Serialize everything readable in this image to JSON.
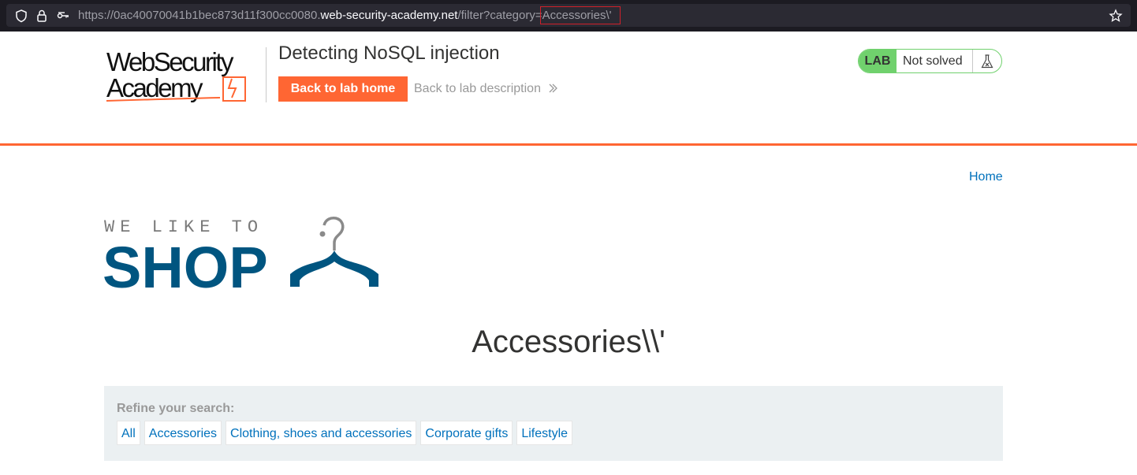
{
  "browser": {
    "url_prefix": "https://0ac40070041b1bec873d11f300cc0080.",
    "url_domain": "web-security-academy.net",
    "url_path": "/filter?category=",
    "url_param": "Accessories\\'"
  },
  "lab_header": {
    "logo_line1": "WebSecurity",
    "logo_line2": "Academy",
    "title": "Detecting NoSQL injection",
    "back_home_label": "Back to lab home",
    "back_description_label": "Back to lab description",
    "status_tag": "LAB",
    "status_text": "Not solved"
  },
  "nav": {
    "home_label": "Home"
  },
  "shop_logo": {
    "tagline": "WE LIKE TO",
    "word": "SHOP"
  },
  "category": {
    "heading": "Accessories\\\\'"
  },
  "filters": {
    "label": "Refine your search:",
    "items": [
      "All",
      "Accessories",
      "Clothing, shoes and accessories",
      "Corporate gifts",
      "Lifestyle"
    ]
  },
  "colors": {
    "accent": "#ff6633",
    "link": "#0071bc",
    "brand_blue": "#005580",
    "solved_green": "#70d16d"
  }
}
